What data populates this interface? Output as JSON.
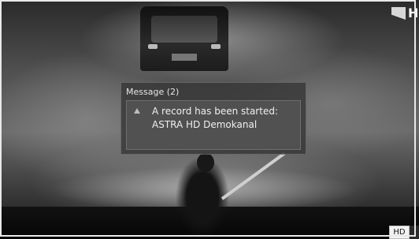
{
  "channel_logo": {
    "letter": "H"
  },
  "message": {
    "title": "Message (2)",
    "icon": "warning-icon",
    "lines": [
      "A record has been started:",
      "ASTRA HD Demokanal"
    ]
  },
  "badge": {
    "label": "HD"
  }
}
